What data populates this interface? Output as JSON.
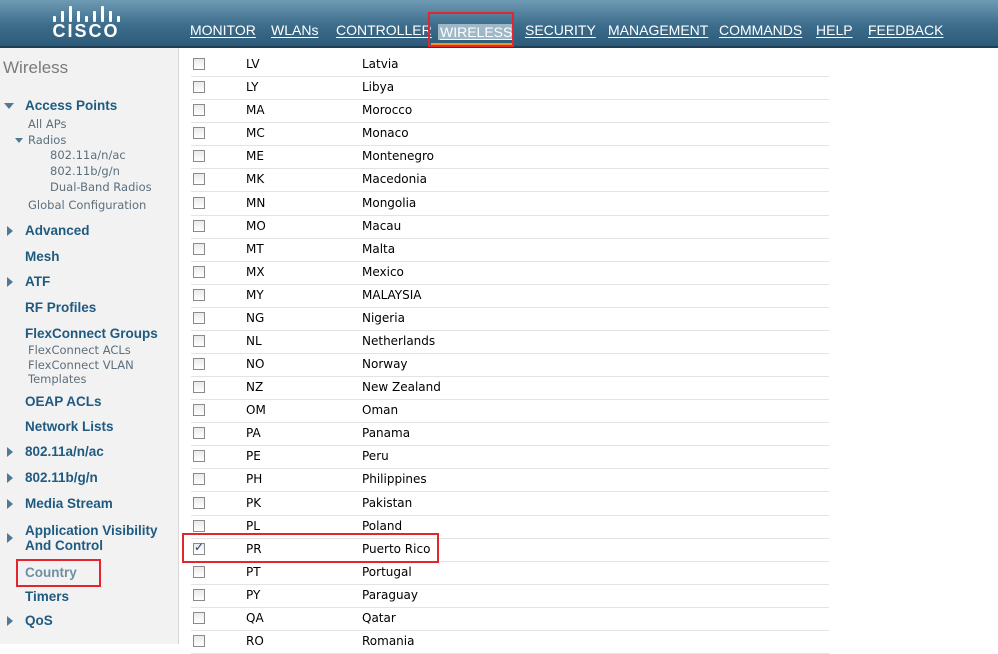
{
  "brand": {
    "logo_text": "CISCO",
    "accent": "#f7941d",
    "highlight": "#e3262e"
  },
  "nav": {
    "items": [
      {
        "label": "MONITOR",
        "active": false
      },
      {
        "label": "WLANs",
        "active": false
      },
      {
        "label": "CONTROLLER",
        "active": false
      },
      {
        "label": "WIRELESS",
        "active": true
      },
      {
        "label": "SECURITY",
        "active": false
      },
      {
        "label": "MANAGEMENT",
        "active": false
      },
      {
        "label": "COMMANDS",
        "active": false
      },
      {
        "label": "HELP",
        "active": false
      },
      {
        "label": "FEEDBACK",
        "active": false
      }
    ]
  },
  "sidebar": {
    "title": "Wireless",
    "access_points": {
      "label": "Access Points",
      "all_aps": "All APs",
      "radios": "Radios",
      "radio_items": [
        "802.11a/n/ac",
        "802.11b/g/n",
        "Dual-Band Radios"
      ],
      "global_config": "Global Configuration"
    },
    "advanced": "Advanced",
    "mesh": "Mesh",
    "atf": "ATF",
    "rf_profiles": "RF Profiles",
    "flexconnect_groups": "FlexConnect Groups",
    "flexconnect_acls": "FlexConnect ACLs",
    "flexconnect_vlan_line1": "FlexConnect VLAN",
    "flexconnect_vlan_line2": "Templates",
    "oeap_acls": "OEAP ACLs",
    "network_lists": "Network Lists",
    "dot11a": "802.11a/n/ac",
    "dot11b": "802.11b/g/n",
    "media_stream": "Media Stream",
    "avc_line1": "Application Visibility",
    "avc_line2": "And Control",
    "country": "Country",
    "timers": "Timers",
    "qos": "QoS"
  },
  "countries": [
    {
      "code": "LV",
      "name": "Latvia",
      "checked": false
    },
    {
      "code": "LY",
      "name": "Libya",
      "checked": false
    },
    {
      "code": "MA",
      "name": "Morocco",
      "checked": false
    },
    {
      "code": "MC",
      "name": "Monaco",
      "checked": false
    },
    {
      "code": "ME",
      "name": "Montenegro",
      "checked": false
    },
    {
      "code": "MK",
      "name": "Macedonia",
      "checked": false
    },
    {
      "code": "MN",
      "name": "Mongolia",
      "checked": false
    },
    {
      "code": "MO",
      "name": "Macau",
      "checked": false
    },
    {
      "code": "MT",
      "name": "Malta",
      "checked": false
    },
    {
      "code": "MX",
      "name": "Mexico",
      "checked": false
    },
    {
      "code": "MY",
      "name": "MALAYSIA",
      "checked": false
    },
    {
      "code": "NG",
      "name": "Nigeria",
      "checked": false
    },
    {
      "code": "NL",
      "name": "Netherlands",
      "checked": false
    },
    {
      "code": "NO",
      "name": "Norway",
      "checked": false
    },
    {
      "code": "NZ",
      "name": "New Zealand",
      "checked": false
    },
    {
      "code": "OM",
      "name": "Oman",
      "checked": false
    },
    {
      "code": "PA",
      "name": "Panama",
      "checked": false
    },
    {
      "code": "PE",
      "name": "Peru",
      "checked": false
    },
    {
      "code": "PH",
      "name": "Philippines",
      "checked": false
    },
    {
      "code": "PK",
      "name": "Pakistan",
      "checked": false
    },
    {
      "code": "PL",
      "name": "Poland",
      "checked": false
    },
    {
      "code": "PR",
      "name": "Puerto Rico",
      "checked": true
    },
    {
      "code": "PT",
      "name": "Portugal",
      "checked": false
    },
    {
      "code": "PY",
      "name": "Paraguay",
      "checked": false
    },
    {
      "code": "QA",
      "name": "Qatar",
      "checked": false
    },
    {
      "code": "RO",
      "name": "Romania",
      "checked": false
    }
  ]
}
